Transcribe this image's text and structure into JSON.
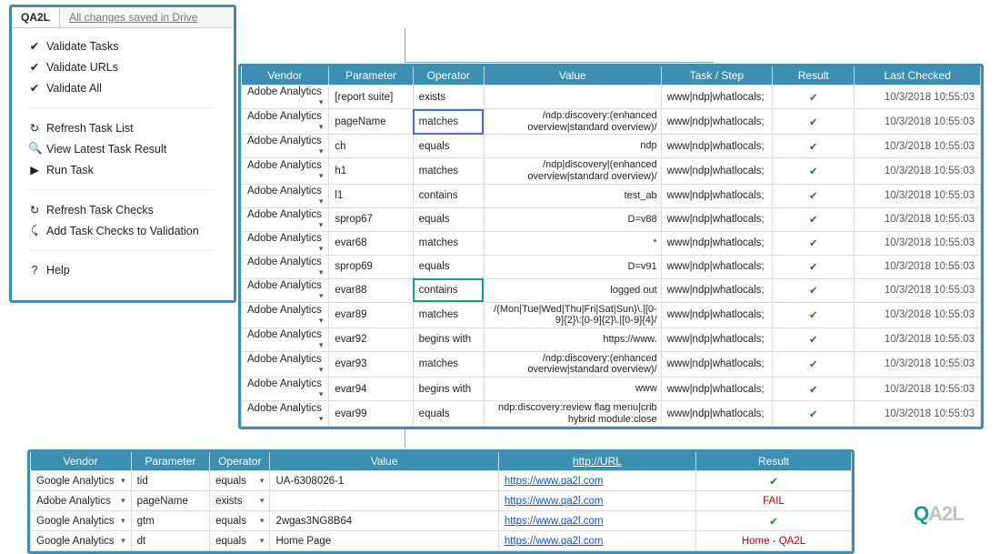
{
  "sidebar": {
    "tab_active": "QA2L",
    "tab_status": "All changes saved in Drive",
    "group1": [
      {
        "icon": "✔",
        "label": "Validate Tasks"
      },
      {
        "icon": "✔",
        "label": "Validate URLs"
      },
      {
        "icon": "✔",
        "label": "Validate All"
      }
    ],
    "group2": [
      {
        "icon": "↻",
        "label": "Refresh Task List"
      },
      {
        "icon": "🔍",
        "label": "View Latest Task Result"
      },
      {
        "icon": "▶",
        "label": "Run Task"
      }
    ],
    "group3": [
      {
        "icon": "↻",
        "label": "Refresh Task Checks"
      },
      {
        "icon": "⤹",
        "label": "Add Task Checks to Validation"
      }
    ],
    "group4": [
      {
        "icon": "?",
        "label": "Help"
      }
    ]
  },
  "topTable": {
    "headers": [
      "Vendor",
      "Parameter",
      "Operator",
      "Value",
      "Task / Step",
      "Result",
      "Last Checked"
    ],
    "rows": [
      {
        "vendor": "Adobe Analytics",
        "param": "[report suite]",
        "op": "exists",
        "val": "",
        "task": "www|ndp|whatlocals;",
        "res": "ok",
        "ts": "10/3/2018 10:55:03"
      },
      {
        "vendor": "Adobe Analytics",
        "param": "pageName",
        "op": "matches",
        "op_sel": true,
        "val": "/ndp:discovery:(enhanced overview|standard overview)/",
        "task": "www|ndp|whatlocals;",
        "res": "ok",
        "ts": "10/3/2018 10:55:03"
      },
      {
        "vendor": "Adobe Analytics",
        "param": "ch",
        "op": "equals",
        "val": "ndp",
        "task": "www|ndp|whatlocals;",
        "res": "ok",
        "ts": "10/3/2018 10:55:03"
      },
      {
        "vendor": "Adobe Analytics",
        "param": "h1",
        "op": "matches",
        "val": "/ndp|discovery|(enhanced overview|standard overview)/",
        "task": "www|ndp|whatlocals;",
        "res": "ok",
        "ts": "10/3/2018 10:55:03"
      },
      {
        "vendor": "Adobe Analytics",
        "param": "l1",
        "op": "contains",
        "val": "test_ab",
        "task": "www|ndp|whatlocals;",
        "res": "ok",
        "ts": "10/3/2018 10:55:03"
      },
      {
        "vendor": "Adobe Analytics",
        "param": "sprop67",
        "op": "equals",
        "val": "D=v88",
        "task": "www|ndp|whatlocals;",
        "res": "ok",
        "ts": "10/3/2018 10:55:03"
      },
      {
        "vendor": "Adobe Analytics",
        "param": "evar68",
        "op": "matches",
        "val": "*",
        "task": "www|ndp|whatlocals;",
        "res": "ok",
        "ts": "10/3/2018 10:55:03"
      },
      {
        "vendor": "Adobe Analytics",
        "param": "sprop69",
        "op": "equals",
        "val": "D=v91",
        "task": "www|ndp|whatlocals;",
        "res": "ok",
        "ts": "10/3/2018 10:55:03"
      },
      {
        "vendor": "Adobe Analytics",
        "param": "evar88",
        "op": "contains",
        "op_hl": true,
        "val": "logged out",
        "task": "www|ndp|whatlocals;",
        "res": "ok",
        "ts": "10/3/2018 10:55:03"
      },
      {
        "vendor": "Adobe Analytics",
        "param": "evar89",
        "op": "matches",
        "val": "/(Mon|Tue|Wed|Thu|Fri|Sat|Sun)\\.|[0-9]{2}\\:[0-9]{2}\\.|[0-9]{4}/",
        "task": "www|ndp|whatlocals;",
        "res": "ok",
        "ts": "10/3/2018 10:55:03"
      },
      {
        "vendor": "Adobe Analytics",
        "param": "evar92",
        "op": "begins with",
        "val": "https://www.",
        "task": "www|ndp|whatlocals;",
        "res": "ok",
        "ts": "10/3/2018 10:55:03"
      },
      {
        "vendor": "Adobe Analytics",
        "param": "evar93",
        "op": "matches",
        "val": "/ndp:discovery:(enhanced overview|standard overview)/",
        "task": "www|ndp|whatlocals;",
        "res": "ok",
        "ts": "10/3/2018 10:55:03"
      },
      {
        "vendor": "Adobe Analytics",
        "param": "evar94",
        "op": "begins with",
        "val": "www",
        "task": "www|ndp|whatlocals;",
        "res": "ok",
        "ts": "10/3/2018 10:55:03"
      },
      {
        "vendor": "Adobe Analytics",
        "param": "evar99",
        "op": "equals",
        "val": "ndp:discovery:review flag menu|crib hybrid module:close",
        "task": "www|ndp|whatlocals;",
        "res": "ok",
        "ts": "10/3/2018 10:55:03"
      }
    ]
  },
  "bottomTable": {
    "headers": [
      "Vendor",
      "Parameter",
      "Operator",
      "Value",
      "http://URL",
      "Result"
    ],
    "rows": [
      {
        "vendor": "Google Analytics",
        "param": "tid",
        "op": "equals",
        "val": "UA-6308026-1",
        "url": "https://www.qa2l.com",
        "res_icon": "ok"
      },
      {
        "vendor": "Adobe Analytics",
        "param": "pageName",
        "op": "exists",
        "val": "",
        "url": "https://www.qa2l.com",
        "res_text": "FAIL",
        "fail": true
      },
      {
        "vendor": "Google Analytics",
        "param": "gtm",
        "op": "equals",
        "val": "2wgas3NG8B64",
        "url": "https://www.qa2l.com",
        "res_icon": "ok"
      },
      {
        "vendor": "Google Analytics",
        "param": "dt",
        "op": "equals",
        "val": "Home Page",
        "url": "https://www.qa2l.com",
        "res_text": "Home - QA2L"
      }
    ]
  },
  "logo": {
    "part1": "Q",
    "part2": "A2L"
  }
}
